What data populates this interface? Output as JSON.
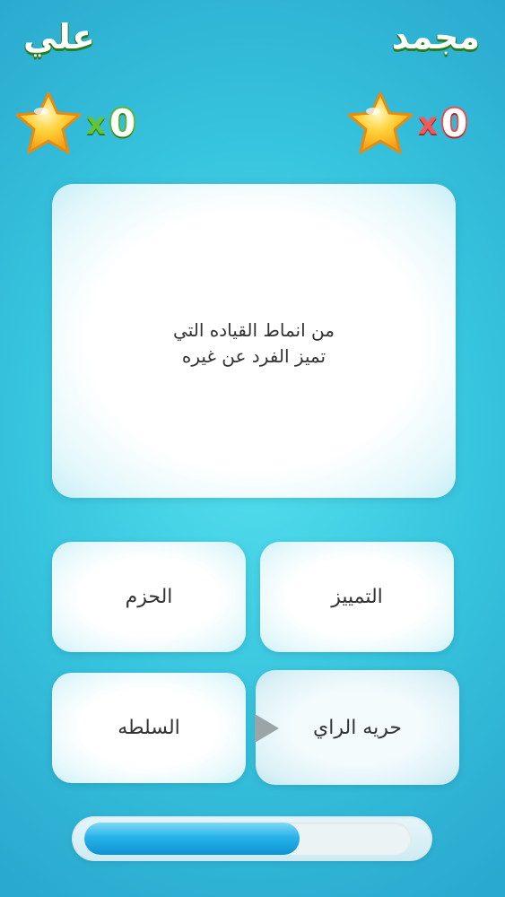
{
  "players": {
    "left": {
      "name": "علي",
      "score": "0",
      "times": "x",
      "color": "#58b83a"
    },
    "right": {
      "name": "مجمد",
      "score": "0",
      "times": "x",
      "color": "#ea4f4f"
    }
  },
  "icons": {
    "star": "star-icon",
    "pointer": "pointer-arrow-icon"
  },
  "question": {
    "text": "من انماط القياده التي\nتميز الفرد عن غيره"
  },
  "answers": {
    "a": "الحزم",
    "b": "التمييز",
    "c": "السلطه",
    "d": "حريه الراي"
  },
  "timer": {
    "progress": 0.66
  }
}
